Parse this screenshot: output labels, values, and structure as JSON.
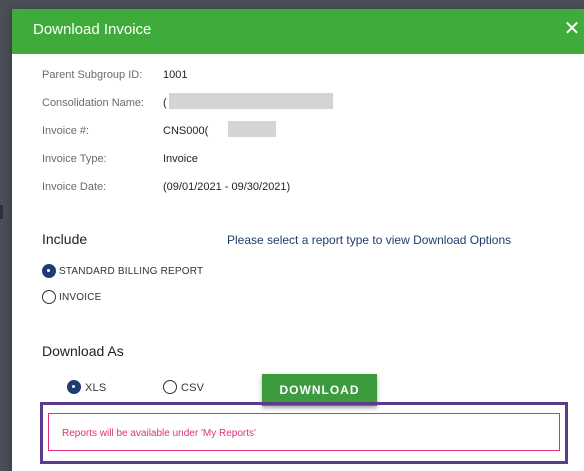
{
  "dialog": {
    "title": "Download Invoice",
    "close_glyph": "✕"
  },
  "details": [
    {
      "label": "Parent Subgroup ID:",
      "value": "1001"
    },
    {
      "label": "Consolidation Name:",
      "value": "("
    },
    {
      "label": "Invoice #:",
      "value": "CNS000("
    },
    {
      "label": "Invoice Type:",
      "value": "Invoice"
    },
    {
      "label": "Invoice Date:",
      "value": "(09/01/2021 - 09/30/2021)"
    }
  ],
  "include": {
    "heading": "Include",
    "hint": "Please select a report type to view Download Options",
    "options": [
      {
        "label": "STANDARD BILLING REPORT",
        "selected": true
      },
      {
        "label": "INVOICE",
        "selected": false
      }
    ]
  },
  "download_as": {
    "heading": "Download As",
    "options": [
      {
        "label": "XLS",
        "selected": true
      },
      {
        "label": "CSV",
        "selected": false
      }
    ],
    "button_label": "DOWNLOAD"
  },
  "notice": "Reports will be available under 'My Reports'",
  "colors": {
    "header_green": "#3fab3b",
    "button_green": "#3c9a3f",
    "radio_navy": "#1e3c72",
    "notice_pink": "#e0307a",
    "highlight_purple": "#5b3c8c"
  }
}
